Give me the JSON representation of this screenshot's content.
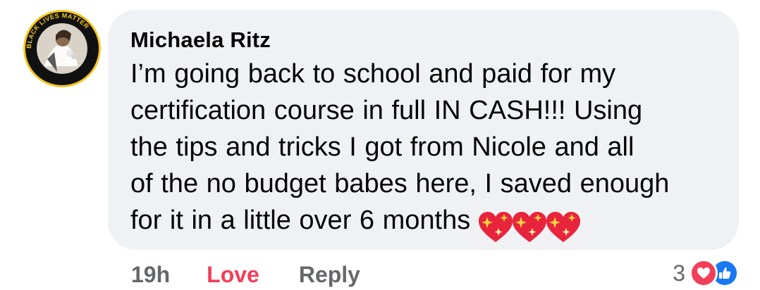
{
  "avatar": {
    "badge_text": "BLACK LIVES MATTER",
    "ring_color": "#f5c518"
  },
  "comment": {
    "author": "Michaela Ritz",
    "text": "I’m going back to school and paid for my\ncertification course in full IN CASH!!! Using\nthe tips and tricks I got from Nicole and all\nof the no budget babes here, I saved enough\nfor it in a little over 6 months",
    "emoji": [
      "sparkling-heart",
      "sparkling-heart",
      "sparkling-heart"
    ]
  },
  "actions": {
    "timestamp": "19h",
    "love_label": "Love",
    "reply_label": "Reply"
  },
  "reactions": {
    "count": "3",
    "types": [
      "love",
      "like"
    ]
  },
  "colors": {
    "bubble_bg": "#eff1f4",
    "love": "#f33e58",
    "like": "#1877f2",
    "muted": "#65676b",
    "text": "#050505"
  }
}
